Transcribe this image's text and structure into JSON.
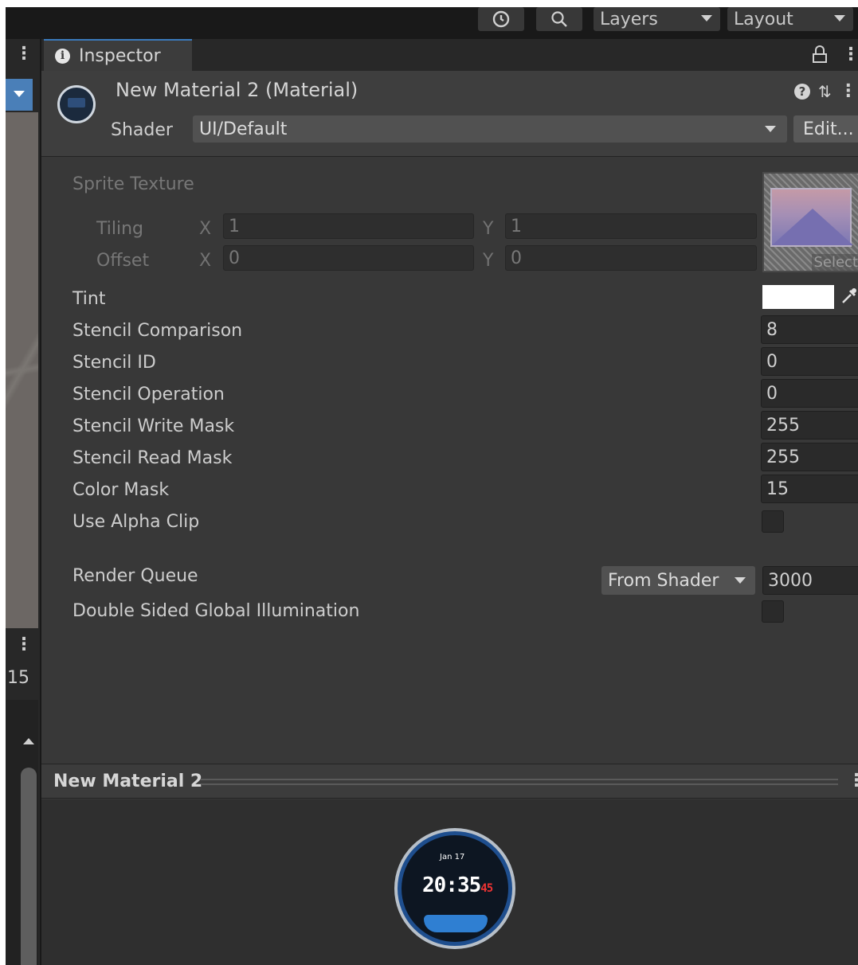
{
  "toolbar": {
    "layers_label": "Layers",
    "layout_label": "Layout"
  },
  "left_panel": {
    "number": "15"
  },
  "inspector": {
    "tab_label": "Inspector",
    "material_title": "New Material 2 (Material)",
    "shader_label": "Shader",
    "shader_value": "UI/Default",
    "edit_label": "Edit...",
    "sprite_texture_label": "Sprite Texture",
    "tiling_label": "Tiling",
    "offset_label": "Offset",
    "x_label": "X",
    "y_label": "Y",
    "tiling_x": "1",
    "tiling_y": "1",
    "offset_x": "0",
    "offset_y": "0",
    "select_label": "Select",
    "tint_label": "Tint",
    "tint_color": "#ffffff",
    "properties": [
      {
        "label": "Stencil Comparison",
        "value": "8"
      },
      {
        "label": "Stencil ID",
        "value": "0"
      },
      {
        "label": "Stencil Operation",
        "value": "0"
      },
      {
        "label": "Stencil Write Mask",
        "value": "255"
      },
      {
        "label": "Stencil Read Mask",
        "value": "255"
      },
      {
        "label": "Color Mask",
        "value": "15"
      }
    ],
    "use_alpha_clip_label": "Use Alpha Clip",
    "use_alpha_clip_checked": false,
    "render_queue_label": "Render Queue",
    "render_queue_mode": "From Shader",
    "render_queue_value": "3000",
    "double_sided_gi_label": "Double Sided Global Illumination",
    "double_sided_gi_checked": false
  },
  "preview": {
    "title": "New Material 2",
    "watch_time": "20:35",
    "watch_seconds": "45",
    "watch_date": "Jan 17"
  },
  "colors": {
    "accent": "#3a79bb",
    "panel_bg": "#383838",
    "toolbar_bg": "#191919"
  }
}
